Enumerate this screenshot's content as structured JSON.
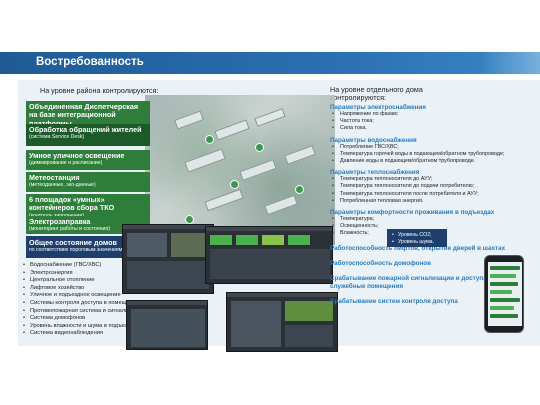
{
  "header": {
    "title": "Востребованность"
  },
  "left": {
    "heading": "На уровне района контролируются:",
    "cards": [
      {
        "title": "Объединенная Диспетчерская на базе интеграционной платформы",
        "subtitle": ""
      },
      {
        "title": "Обработка обращений жителей",
        "subtitle": "(система Service Desk)"
      },
      {
        "title": "Умное уличное освещение",
        "subtitle": "(диммирование и расписание)"
      },
      {
        "title": "Метеостанция",
        "subtitle": "(метеоданные, эко-данные)"
      },
      {
        "title": "6 площадок «умных» контейнеров сбора ТКО",
        "subtitle": "(контроль заполнения)"
      },
      {
        "title": "Электрозаправка",
        "subtitle": "(мониторинг работы и состояния)"
      }
    ],
    "general": {
      "title": "Общее состояние домов",
      "subtitle": "по соответствию пороговым значениям параметров:"
    },
    "monitor_list": [
      "Водоснабжение (ГВС/ХВС)",
      "Электроэнергия",
      "Центральное отопление",
      "Лифтовое хозяйство",
      "Уличное и подъездное освещение",
      "Системы контроля доступа в помещения",
      "Противопожарная система и сигнализация",
      "Система домофонов",
      "Уровень влажности и шума в подъездах",
      "Система видеонаблюдения"
    ]
  },
  "right": {
    "heading": "На уровне отдельного дома контролируются:",
    "sections": [
      {
        "title": "Параметры электроснабжения",
        "items": [
          "Напряжение по фазам;",
          "Частота тока;",
          "Сила тока."
        ]
      },
      {
        "title": "Параметры водоснабжения",
        "items": [
          "Потребление ГВС/ХВС;",
          "Температура горячей воды в подающем/обратном трубопроводе;",
          "Давление воды в подающем/обратном трубопроводе."
        ]
      },
      {
        "title": "Параметры теплоснабжения",
        "items": [
          "Температура теплоносителя до АУУ;",
          "Температура теплоносителя до подачи потребителю;",
          "Температура теплоносителя после потребителя и АУУ;",
          "Потребленная тепловая энергия."
        ]
      },
      {
        "title": "Параметры комфортности проживания в подъездах",
        "items": [
          "Температура;",
          "Освещенность;",
          "Влажность;"
        ]
      }
    ],
    "popup_items": [
      "Уровень CO2;",
      "Уровень шума."
    ],
    "lines": [
      "Работоспособность лифтов, открытие дверей в шахтах",
      "Работоспособность домофонов",
      "Срабатывание пожарной сигнализации и доступа в служебные помещения",
      "Срабатывание систем контроля доступа"
    ]
  },
  "colors": {
    "banner": "#2a6fb0",
    "card": "#2f7d3b",
    "accent": "#2a7dbf",
    "dark_blue": "#1e3f6e"
  }
}
